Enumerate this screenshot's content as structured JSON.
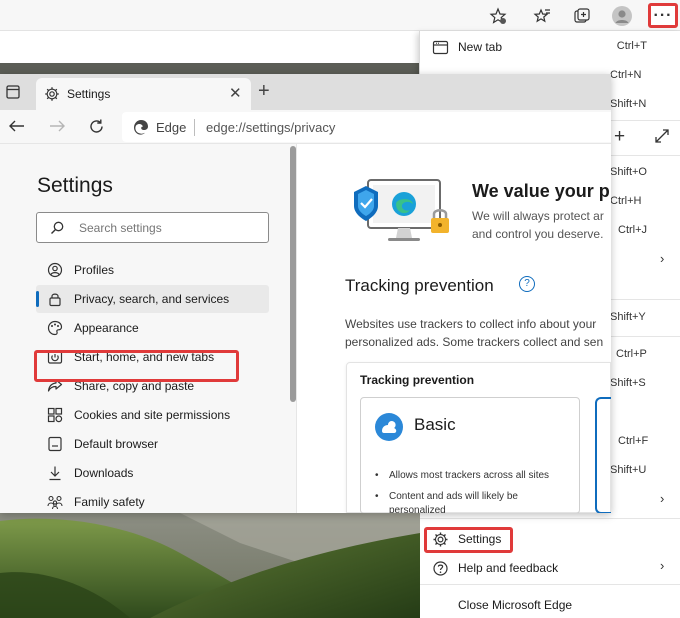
{
  "bg_browser": {
    "more_label": "···"
  },
  "menu": {
    "items": [
      {
        "label": "New tab",
        "shortcut": "Ctrl+T"
      }
    ],
    "shortcuts": [
      "Ctrl+N",
      "Shift+N",
      "Shift+O",
      "Ctrl+H",
      "Ctrl+J",
      "Shift+Y",
      "Ctrl+P",
      "Shift+S",
      "Ctrl+F",
      "Shift+U"
    ],
    "settings_label": "Settings",
    "help_label": "Help and feedback",
    "close_label": "Close Microsoft Edge"
  },
  "window": {
    "tab_title": "Settings",
    "address_brand": "Edge",
    "address_url": "edge://settings/privacy"
  },
  "sidebar": {
    "title": "Settings",
    "search_placeholder": "Search settings",
    "items": [
      {
        "label": "Profiles",
        "icon": "person-icon"
      },
      {
        "label": "Privacy, search, and services",
        "icon": "lock-icon",
        "active": true
      },
      {
        "label": "Appearance",
        "icon": "palette-icon"
      },
      {
        "label": "Start, home, and new tabs",
        "icon": "power-icon"
      },
      {
        "label": "Share, copy and paste",
        "icon": "share-icon"
      },
      {
        "label": "Cookies and site permissions",
        "icon": "cookies-icon"
      },
      {
        "label": "Default browser",
        "icon": "browser-icon"
      },
      {
        "label": "Downloads",
        "icon": "download-icon"
      },
      {
        "label": "Family safety",
        "icon": "family-icon"
      }
    ]
  },
  "main": {
    "hero_title": "We value your p",
    "hero_line1": "We will always protect ar",
    "hero_line2": "and control you deserve.",
    "tracking_heading": "Tracking prevention",
    "tracking_desc1": "Websites use trackers to collect info about your",
    "tracking_desc2": "personalized ads. Some trackers collect and sen",
    "card_title": "Tracking prevention",
    "basic_title": "Basic",
    "basic_bullet1": "Allows most trackers across all sites",
    "basic_bullet2a": "Content and ads will likely be",
    "basic_bullet2b": "personalized"
  },
  "colors": {
    "highlight_red": "#e03a3a",
    "accent_blue": "#0f6cbd"
  }
}
